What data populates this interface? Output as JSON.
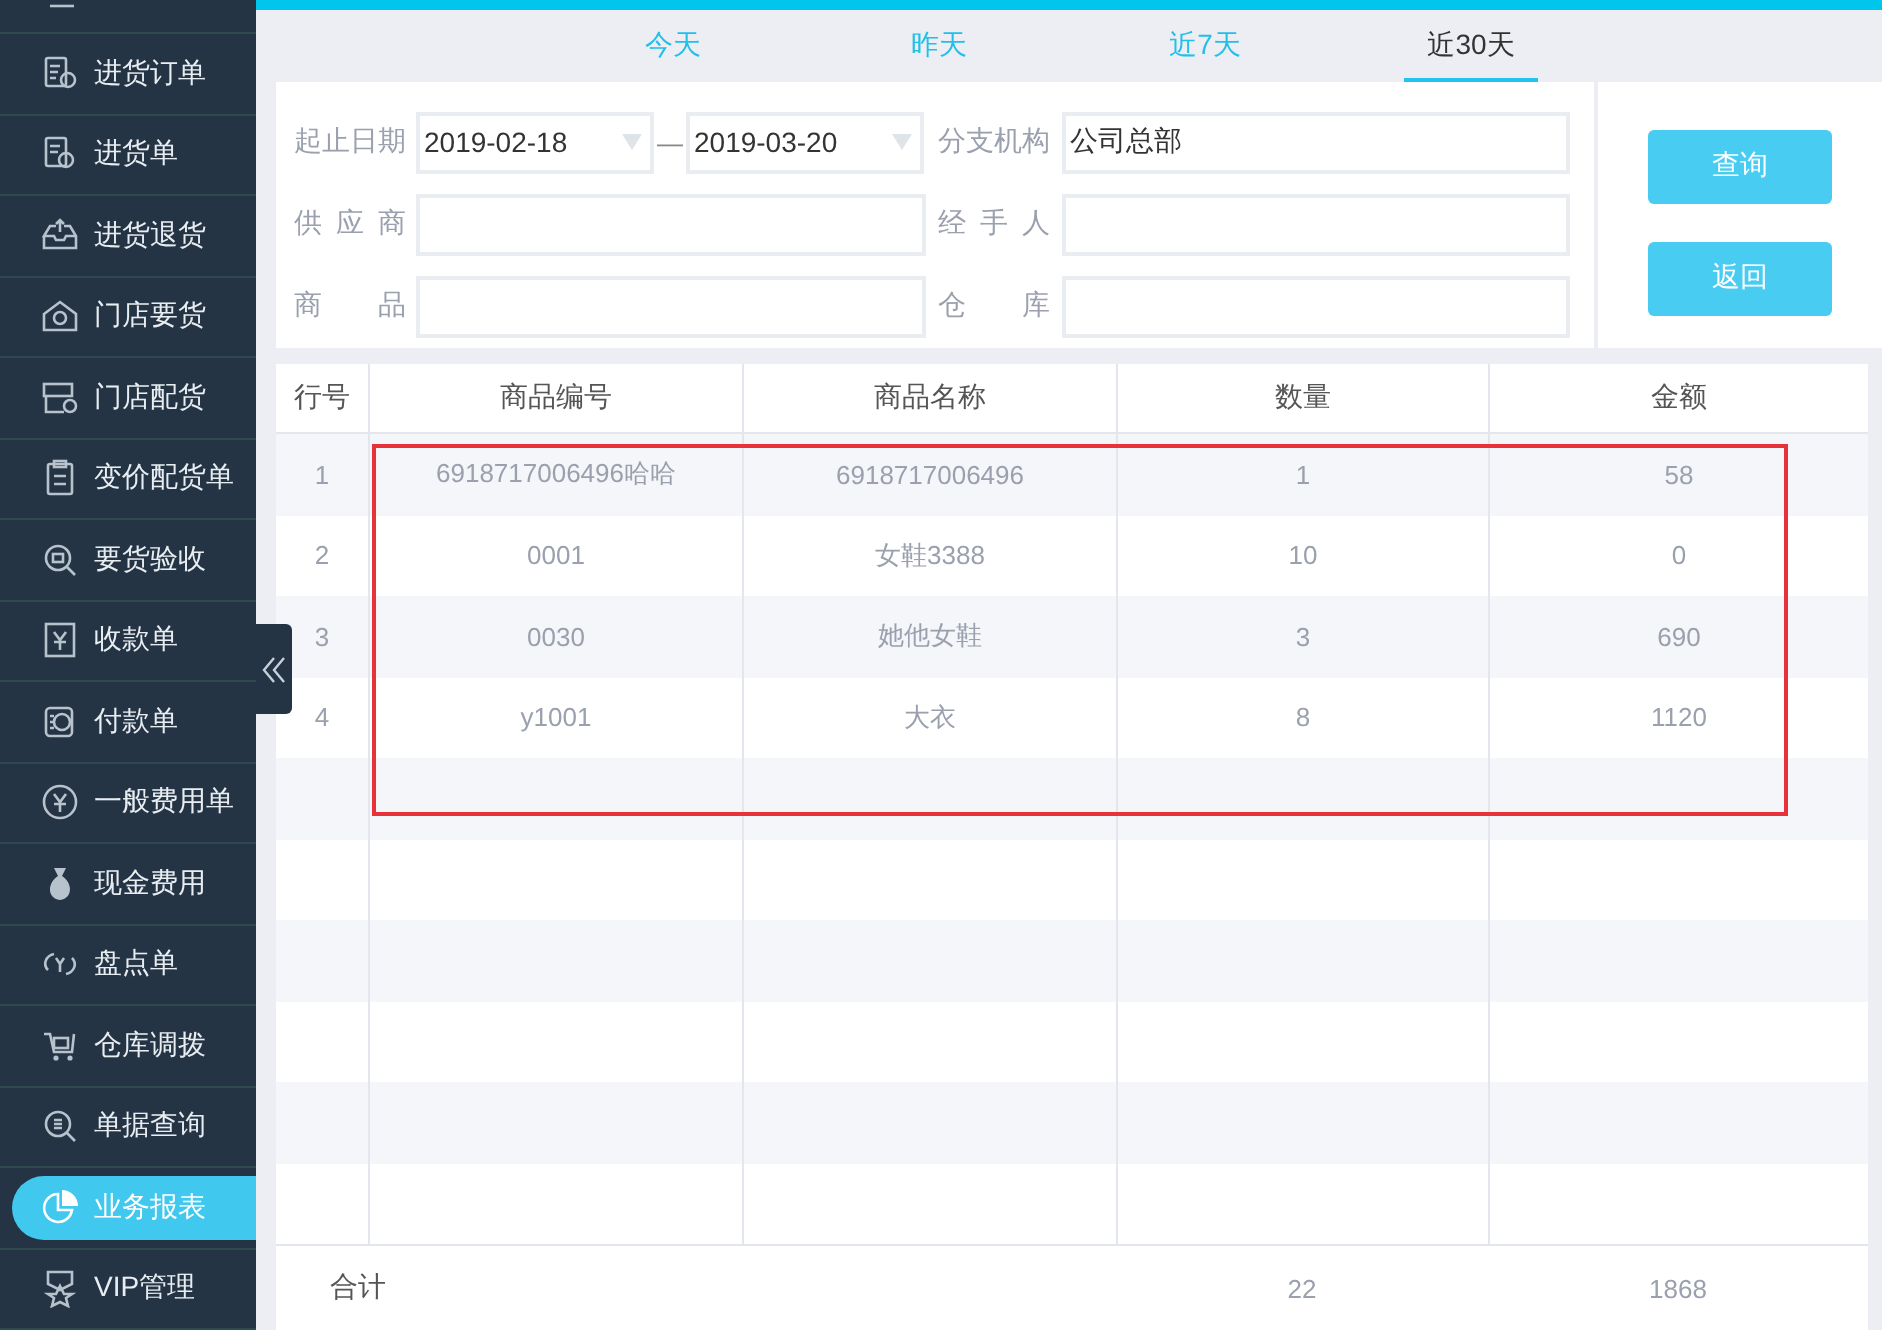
{
  "sidebar": {
    "items": [
      {
        "label": "进货订单",
        "selected": false
      },
      {
        "label": "进货单",
        "selected": false
      },
      {
        "label": "进货退货",
        "selected": false
      },
      {
        "label": "门店要货",
        "selected": false
      },
      {
        "label": "门店配货",
        "selected": false
      },
      {
        "label": "变价配货单",
        "selected": false
      },
      {
        "label": "要货验收",
        "selected": false
      },
      {
        "label": "收款单",
        "selected": false
      },
      {
        "label": "付款单",
        "selected": false
      },
      {
        "label": "一般费用单",
        "selected": false
      },
      {
        "label": "现金费用",
        "selected": false
      },
      {
        "label": "盘点单",
        "selected": false
      },
      {
        "label": "仓库调拨",
        "selected": false
      },
      {
        "label": "单据查询",
        "selected": false
      },
      {
        "label": "业务报表",
        "selected": true
      },
      {
        "label": "VIP管理",
        "selected": false
      }
    ]
  },
  "tabs": [
    {
      "label": "今天",
      "selected": false
    },
    {
      "label": "昨天",
      "selected": false
    },
    {
      "label": "近7天",
      "selected": false
    },
    {
      "label": "近30天",
      "selected": true
    }
  ],
  "filters": [
    {
      "kind": "date_range",
      "label": "起止日期",
      "from": "2019-02-18",
      "separator": "—",
      "to": "2019-03-20"
    },
    {
      "kind": "text",
      "label": "分支机构",
      "value": "公司总部"
    },
    {
      "kind": "text",
      "label": "供应商"
    },
    {
      "kind": "text",
      "label": "经手人"
    },
    {
      "kind": "text",
      "label": "商品"
    },
    {
      "kind": "text",
      "label": "仓库"
    }
  ],
  "buttons": [
    "查询",
    "返回"
  ],
  "table": {
    "columns": [
      "行号",
      "商品编号",
      "商品名称",
      "数量",
      "金额"
    ],
    "rows": [
      [
        "1",
        "6918717006496哈哈",
        "6918717006496",
        "1",
        "58"
      ],
      [
        "2",
        "0001",
        "女鞋3388",
        "10",
        "0"
      ],
      [
        "3",
        "0030",
        "她他女鞋",
        "3",
        "690"
      ],
      [
        "4",
        "y1001",
        "大衣",
        "8",
        "1120"
      ]
    ],
    "totals": {
      "label": "合计",
      "quantity": "22",
      "amount": "1868"
    }
  }
}
